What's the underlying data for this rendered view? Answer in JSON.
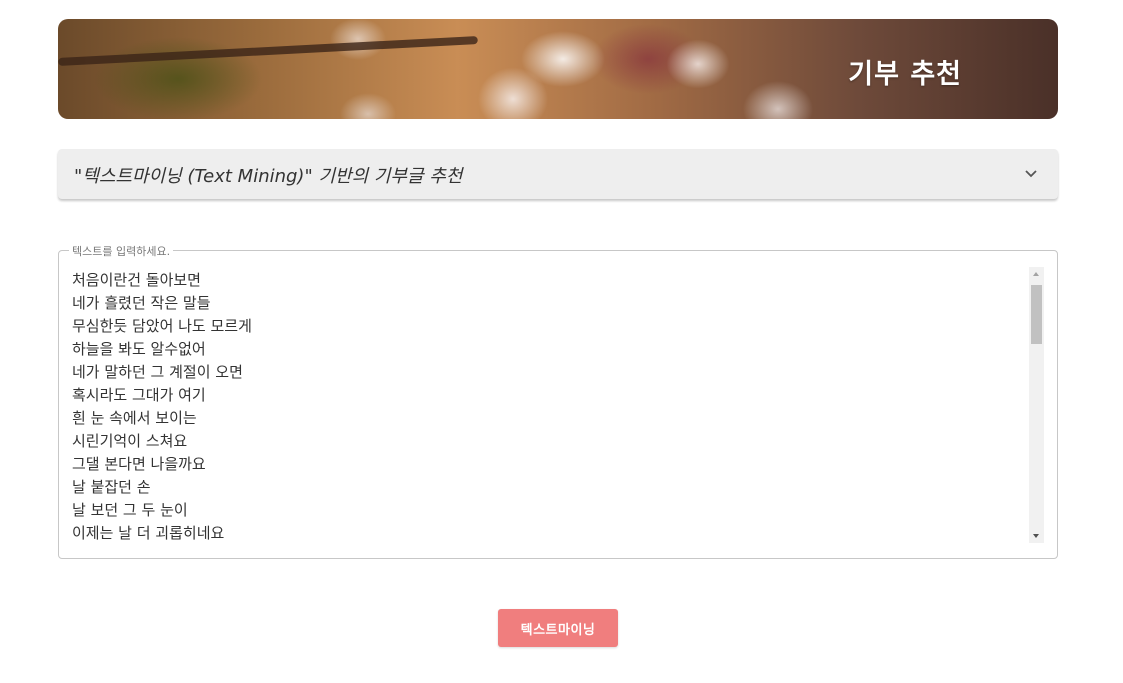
{
  "banner": {
    "title": "기부 추천"
  },
  "accordion": {
    "title": "\"텍스트마이닝 (Text Mining)\" 기반의 기부글 추천",
    "icon": "chevron-down-icon"
  },
  "text_field": {
    "label": "텍스트를 입력하세요.",
    "value": "처음이란건 돌아보면\n네가 흘렸던 작은 말들\n무심한듯 담았어 나도 모르게\n하늘을 봐도 알수없어\n네가 말하던 그 계절이 오면\n혹시라도 그대가 여기\n흰 눈 속에서 보이는\n시린기억이 스쳐요\n그댈 본다면 나을까요\n날 붙잡던 손\n날 보던 그 두 눈이\n이제는 날 더 괴롭히네요"
  },
  "button": {
    "label": "텍스트마이닝"
  },
  "colors": {
    "button_bg": "#f07e7e",
    "accordion_bg": "#eeeeee"
  }
}
